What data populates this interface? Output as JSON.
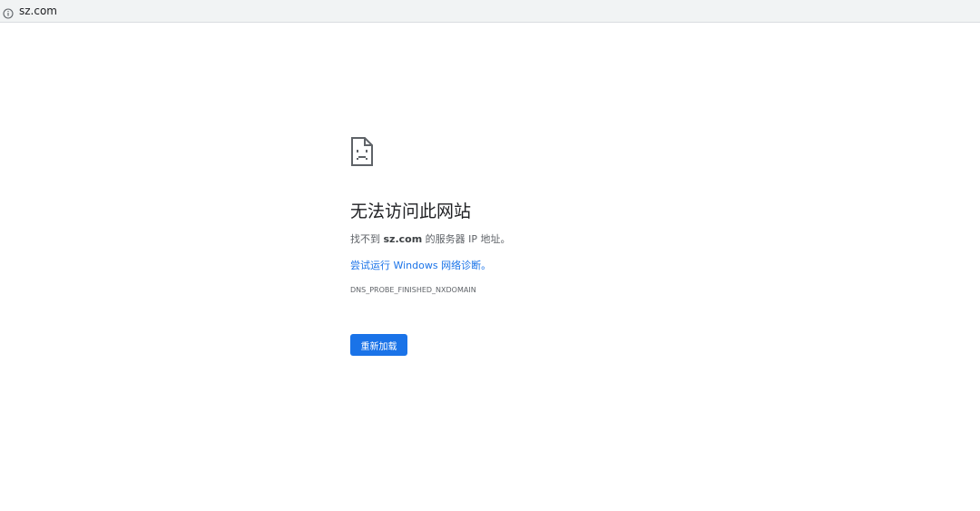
{
  "address_bar": {
    "url": "sz.com",
    "icon": "info-icon"
  },
  "error": {
    "icon": "sad-document-icon",
    "title": "无法访问此网站",
    "desc_prefix": "找不到 ",
    "desc_domain": "sz.com",
    "desc_suffix": " 的服务器 IP 地址。",
    "diagnose_link": "尝试运行 Windows 网络诊断",
    "diagnose_suffix": "。",
    "code": "DNS_PROBE_FINISHED_NXDOMAIN",
    "reload_label": "重新加载"
  },
  "colors": {
    "accent": "#1a73e8",
    "text": "#5f6368",
    "title": "#202124"
  }
}
